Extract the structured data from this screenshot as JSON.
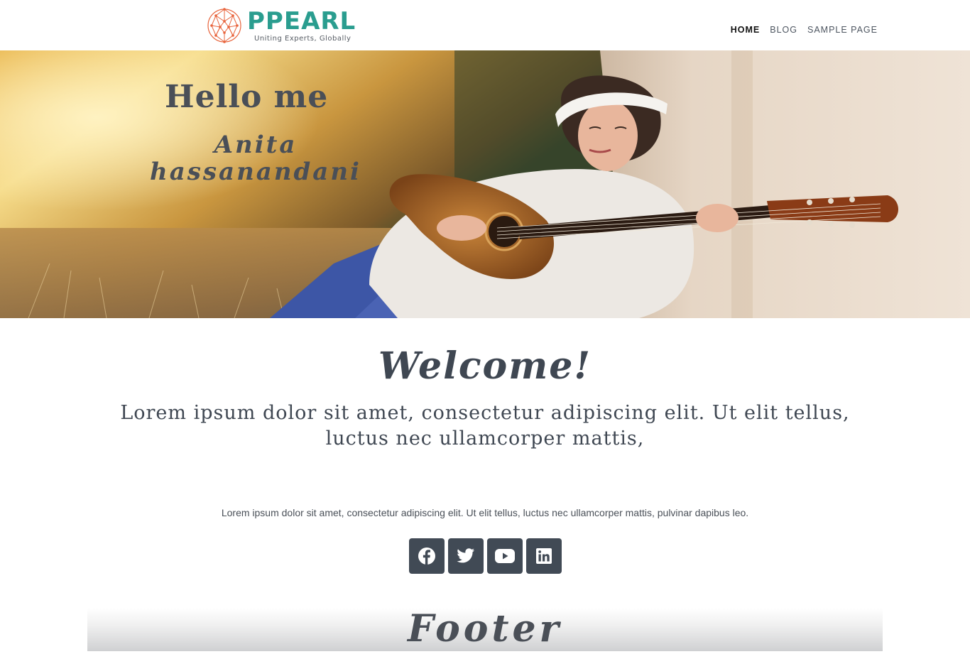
{
  "brand": {
    "name": "PPEARL",
    "tagline": "Uniting Experts, Globally",
    "color": "#2a9d8f"
  },
  "nav": {
    "items": [
      {
        "label": "HOME",
        "active": true
      },
      {
        "label": "BLOG",
        "active": false
      },
      {
        "label": "SAMPLE PAGE",
        "active": false
      }
    ]
  },
  "hero": {
    "title": "Hello me",
    "name": "Anita hassanandani"
  },
  "welcome": {
    "heading": "Welcome!",
    "lead": "Lorem ipsum dolor sit amet, consectetur adipiscing elit. Ut elit tellus, luctus nec ullamcorper mattis,",
    "body": "Lorem ipsum dolor sit amet, consectetur adipiscing elit. Ut elit tellus, luctus nec ullamcorper mattis, pulvinar dapibus leo."
  },
  "social": {
    "icons": [
      "facebook-icon",
      "twitter-icon",
      "youtube-icon",
      "linkedin-icon"
    ],
    "button_color": "#414a55"
  },
  "footer": {
    "title": "Footer"
  }
}
